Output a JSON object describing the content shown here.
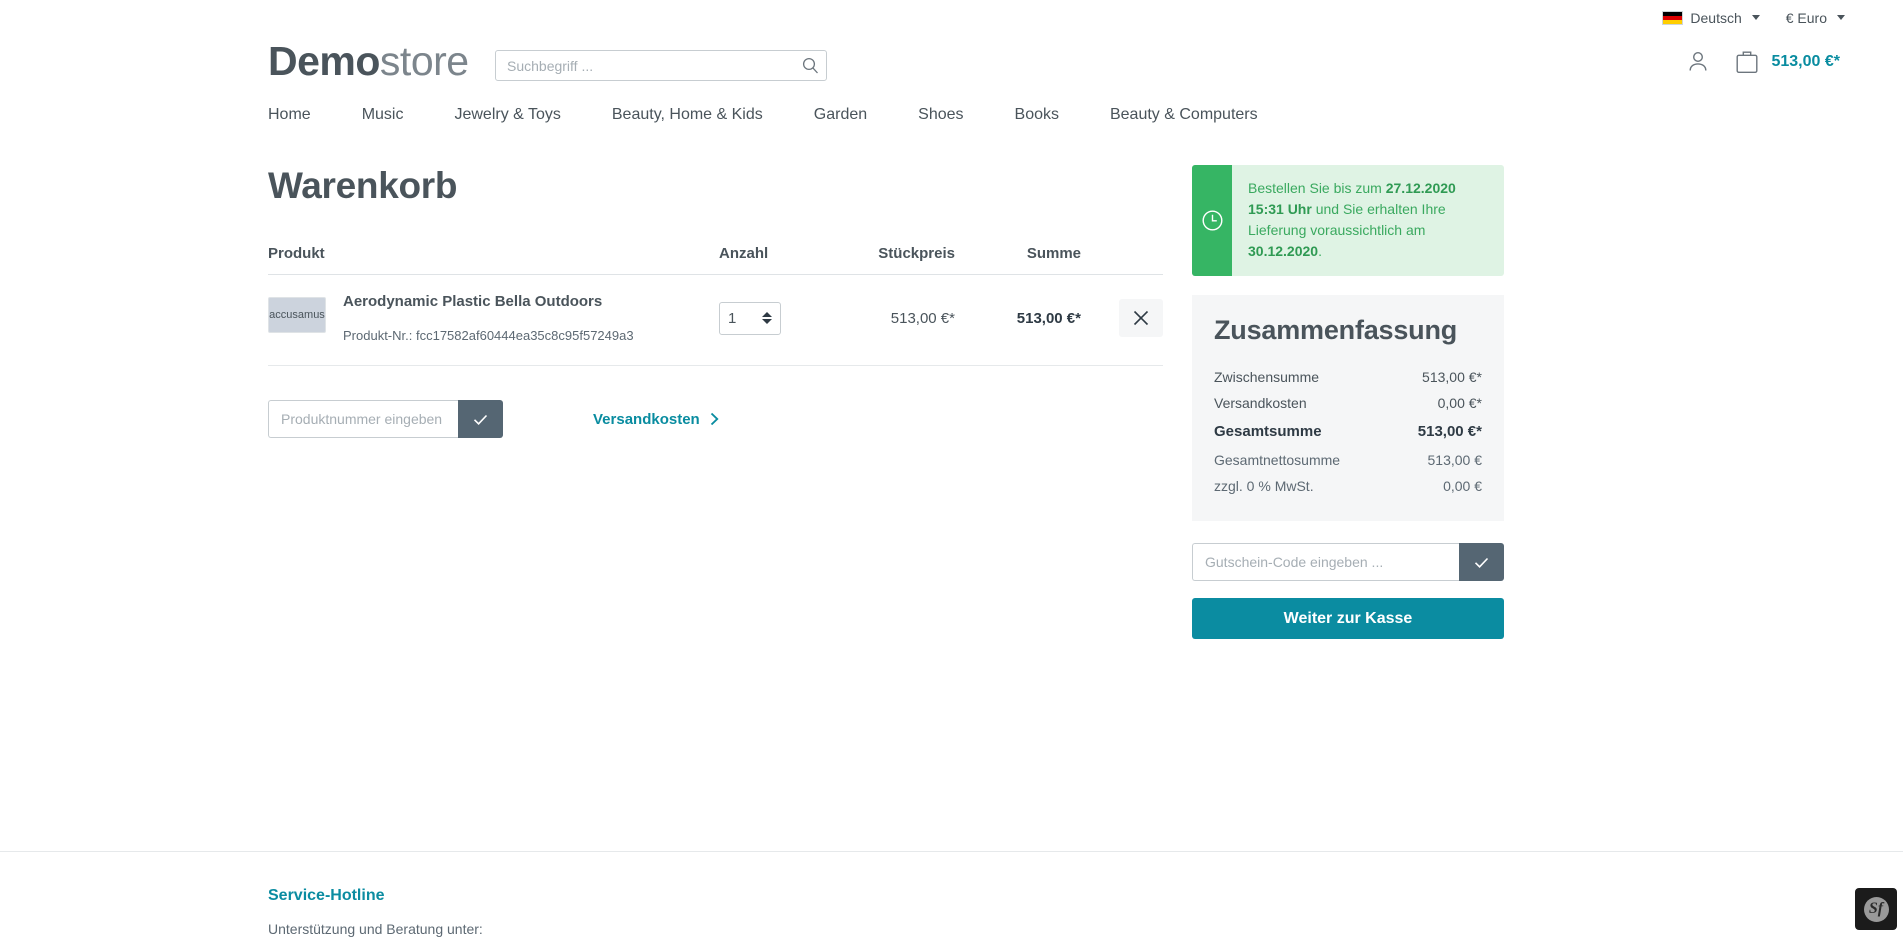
{
  "topbar": {
    "language": "Deutsch",
    "language_flag_icon": "german-flag-icon",
    "currency": "€ Euro"
  },
  "header": {
    "logo_bold": "Demo",
    "logo_light": "store",
    "search_placeholder": "Suchbegriff ...",
    "search_value": "",
    "search_icon": "search-icon",
    "account_icon": "user-icon",
    "cart_icon": "shopping-bag-icon",
    "cart_total": "513,00 €*"
  },
  "nav": {
    "items": [
      {
        "label": "Home"
      },
      {
        "label": "Music"
      },
      {
        "label": "Jewelry & Toys"
      },
      {
        "label": "Beauty, Home & Kids"
      },
      {
        "label": "Garden"
      },
      {
        "label": "Shoes"
      },
      {
        "label": "Books"
      },
      {
        "label": "Beauty & Computers"
      }
    ]
  },
  "cart": {
    "title": "Warenkorb",
    "columns": {
      "product": "Produkt",
      "quantity": "Anzahl",
      "unit_price": "Stückpreis",
      "total": "Summe"
    },
    "items": [
      {
        "thumb_text": "accusamus",
        "name": "Aerodynamic Plastic Bella Outdoors",
        "product_number_label": "Produkt-Nr.:",
        "product_number": "fcc17582af60444ea35c8c95f57249a3",
        "quantity": "1",
        "unit_price": "513,00 €*",
        "total": "513,00 €*",
        "remove_icon": "close-icon"
      }
    ],
    "product_number_placeholder": "Produktnummer eingeben ...",
    "product_number_value": "",
    "submit_icon": "check-icon",
    "shipping_link": "Versandkosten",
    "shipping_chevron_icon": "chevron-right-icon"
  },
  "notice": {
    "clock_icon": "clock-icon",
    "prefix": "Bestellen Sie bis zum ",
    "deadline_date": "27.12.2020",
    "deadline_time": "15:31 Uhr",
    "middle": " und Sie erhalten Ihre Lieferung voraussichtlich am ",
    "delivery_date": "30.12.2020",
    "suffix": "."
  },
  "summary": {
    "title": "Zusammenfassung",
    "rows": [
      {
        "label": "Zwischensumme",
        "value": "513,00 €*",
        "emphasis": "normal"
      },
      {
        "label": "Versandkosten",
        "value": "0,00 €*",
        "emphasis": "normal"
      },
      {
        "label": "Gesamtsumme",
        "value": "513,00 €*",
        "emphasis": "total"
      },
      {
        "label": "Gesamtnettosumme",
        "value": "513,00 €",
        "emphasis": "muted"
      },
      {
        "label": "zzgl. 0 % MwSt.",
        "value": "0,00 €",
        "emphasis": "muted"
      }
    ],
    "voucher_placeholder": "Gutschein-Code eingeben ...",
    "voucher_value": "",
    "voucher_submit_icon": "check-icon",
    "checkout_label": "Weiter zur Kasse"
  },
  "footer": {
    "title": "Service-Hotline",
    "subtitle": "Unterstützung und Beratung unter:"
  },
  "debug_toolbar": {
    "symbol": "Sf",
    "icon": "symfony-icon"
  },
  "colors": {
    "accent_teal": "#0b8ca1",
    "notice_green": "#36b564",
    "notice_bg": "#dff3e4",
    "text": "#4a545b",
    "panel_bg": "#f5f6f7",
    "button_slate": "#556673"
  }
}
